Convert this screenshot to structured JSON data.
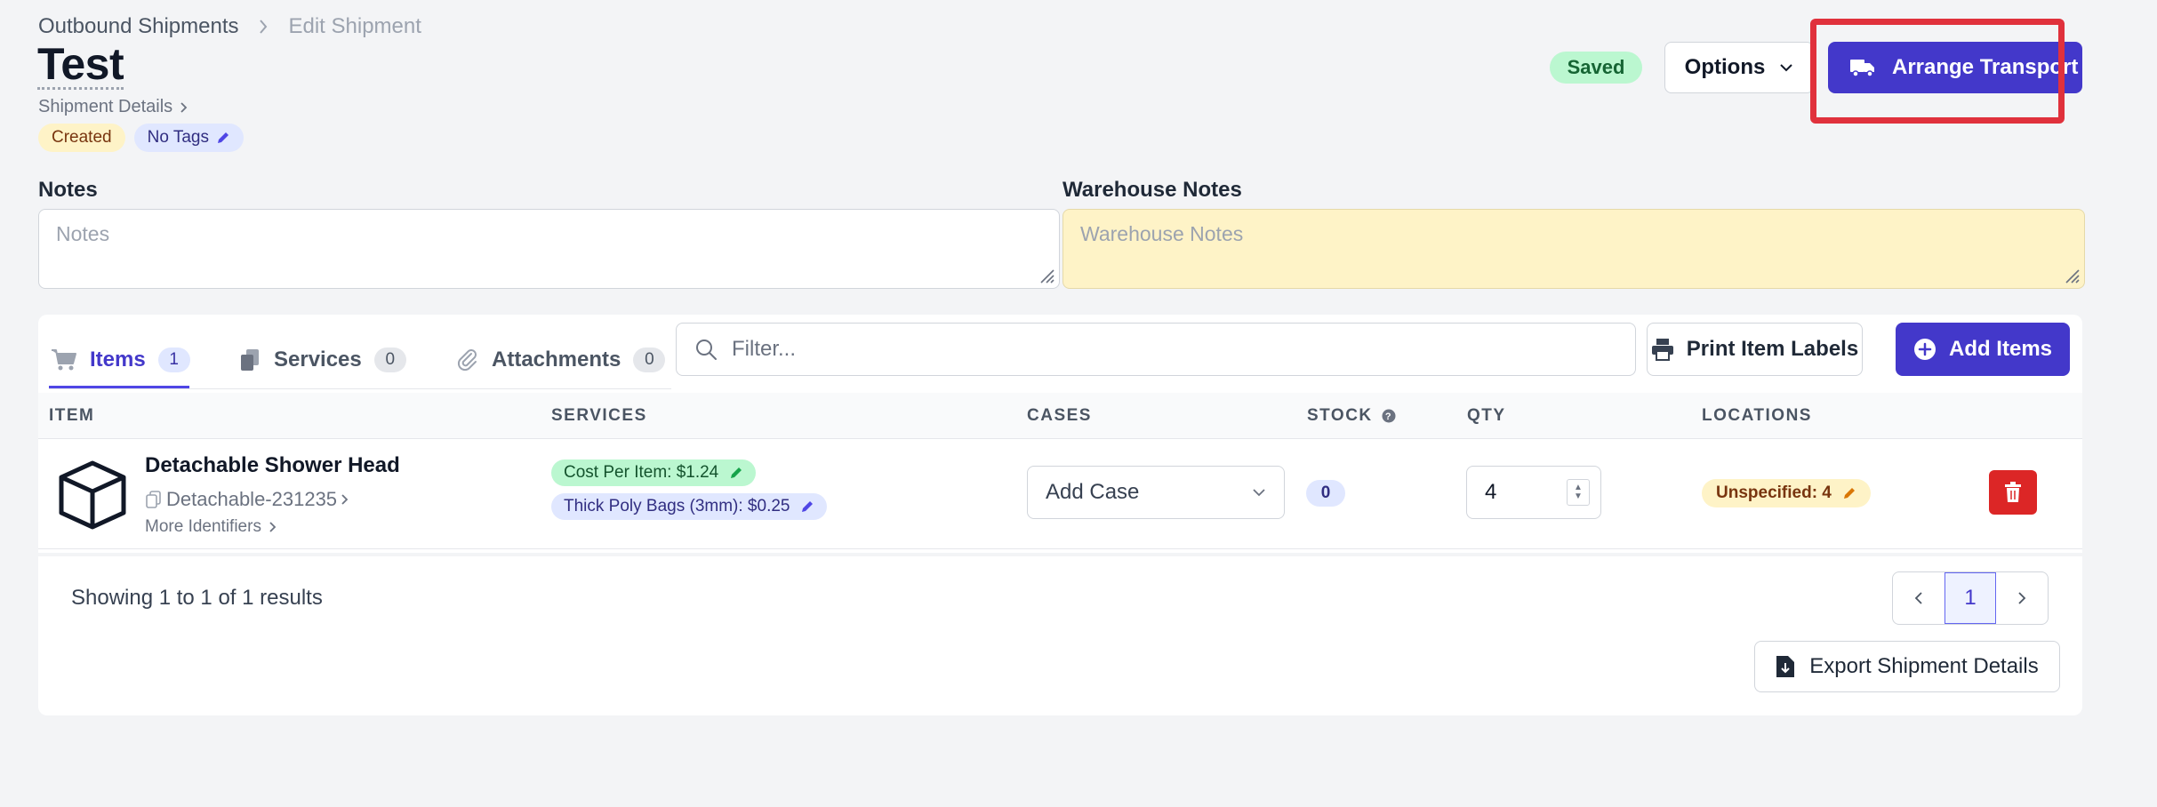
{
  "breadcrumb": {
    "parent": "Outbound Shipments",
    "current": "Edit Shipment"
  },
  "header": {
    "title": "Test",
    "subtitle_link": "Shipment Details",
    "status_badge": "Created",
    "tags_badge": "No Tags",
    "saved_label": "Saved",
    "options_label": "Options",
    "arrange_label": "Arrange Transport"
  },
  "notes": {
    "label": "Notes",
    "placeholder": "Notes",
    "value": ""
  },
  "warehouse_notes": {
    "label": "Warehouse Notes",
    "placeholder": "Warehouse Notes",
    "value": ""
  },
  "tabs": [
    {
      "label": "Items",
      "count": "1"
    },
    {
      "label": "Services",
      "count": "0"
    },
    {
      "label": "Attachments",
      "count": "0"
    }
  ],
  "toolbar": {
    "filter_placeholder": "Filter...",
    "print_label": "Print Item Labels",
    "add_label": "Add Items"
  },
  "table": {
    "columns": [
      "ITEM",
      "SERVICES",
      "CASES",
      "STOCK",
      "QTY",
      "LOCATIONS"
    ],
    "rows": [
      {
        "name": "Detachable Shower Head",
        "sku": "Detachable-231235",
        "more": "More Identifiers",
        "services": [
          "Cost Per Item: $1.24",
          "Thick Poly Bags (3mm): $0.25"
        ],
        "case_placeholder": "Add Case",
        "stock": "0",
        "qty": "4",
        "location": "Unspecified: 4"
      }
    ]
  },
  "footer": {
    "showing": "Showing 1 to 1 of 1 results",
    "page": "1",
    "export_label": "Export Shipment Details"
  },
  "colors": {
    "primary": "#4338ca",
    "highlight": "#e0313c",
    "danger": "#dc2626",
    "warning_bg": "#fef3c7",
    "success_bg": "#bbf7d0"
  }
}
